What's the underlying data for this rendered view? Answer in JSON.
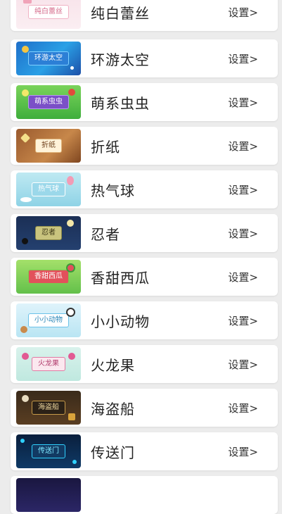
{
  "themes": [
    {
      "name": "纯白蕾丝",
      "thumb_label": "纯白蕾丝",
      "setting": "设置>",
      "bg": "linear-gradient(180deg,#f8e3ea,#fbeef2)",
      "plaque_bg": "#ffffff",
      "plaque_fg": "#d46a8a",
      "plaque_border": "#f0b3c5"
    },
    {
      "name": "环游太空",
      "thumb_label": "环游太空",
      "setting": "设置>",
      "bg": "linear-gradient(135deg,#1f6fc9,#2aa0e6 55%,#1c4fa8)",
      "plaque_bg": "#2c7fd6",
      "plaque_fg": "#ffffff",
      "plaque_border": "#7fd0ff"
    },
    {
      "name": "萌系虫虫",
      "thumb_label": "萌系虫虫",
      "setting": "设置>",
      "bg": "linear-gradient(180deg,#7ad35a,#3fae3c)",
      "plaque_bg": "#7b4fc7",
      "plaque_fg": "#ffffff",
      "plaque_border": "#b89af0"
    },
    {
      "name": "折纸",
      "thumb_label": "折纸",
      "setting": "设置>",
      "bg": "linear-gradient(135deg,#9a5a2e,#c7874a 60%,#7f4620)",
      "plaque_bg": "#fff3d9",
      "plaque_fg": "#6b3d18",
      "plaque_border": "#e0b47a"
    },
    {
      "name": "热气球",
      "thumb_label": "热气球",
      "setting": "设置>",
      "bg": "linear-gradient(180deg,#bfe9f2,#8fd3e6)",
      "plaque_bg": "#9bd8ea",
      "plaque_fg": "#ffffff",
      "plaque_border": "#ffffff"
    },
    {
      "name": "忍者",
      "thumb_label": "忍者",
      "setting": "设置>",
      "bg": "linear-gradient(180deg,#1b2f55,#24406f)",
      "plaque_bg": "#c9c47e",
      "plaque_fg": "#3a3415",
      "plaque_border": "#8d8a4a"
    },
    {
      "name": "香甜西瓜",
      "thumb_label": "香甜西瓜",
      "setting": "设置>",
      "bg": "linear-gradient(180deg,#a4e06a,#63c04a)",
      "plaque_bg": "#e2515b",
      "plaque_fg": "#ffffff",
      "plaque_border": "#7cc84e"
    },
    {
      "name": "小小动物",
      "thumb_label": "小小动物",
      "setting": "设置>",
      "bg": "linear-gradient(180deg,#dff3fb,#b9e5f3)",
      "plaque_bg": "#ffffff",
      "plaque_fg": "#2a86b8",
      "plaque_border": "#6cc2e8"
    },
    {
      "name": "火龙果",
      "thumb_label": "火龙果",
      "setting": "设置>",
      "bg": "linear-gradient(180deg,#d9f2ec,#bfe8df)",
      "plaque_bg": "#fbe8ef",
      "plaque_fg": "#b03a6b",
      "plaque_border": "#e07aa3"
    },
    {
      "name": "海盗船",
      "thumb_label": "海盗船",
      "setting": "设置>",
      "bg": "linear-gradient(180deg,#3a2a1a,#5a3e22)",
      "plaque_bg": "#2b2117",
      "plaque_fg": "#f0d9a0",
      "plaque_border": "#c79b4a"
    },
    {
      "name": "传送门",
      "thumb_label": "传送门",
      "setting": "设置>",
      "bg": "linear-gradient(180deg,#0a1f3d,#0f3a66)",
      "plaque_bg": "#123a63",
      "plaque_fg": "#7ee8ff",
      "plaque_border": "#2fd2ff"
    }
  ]
}
